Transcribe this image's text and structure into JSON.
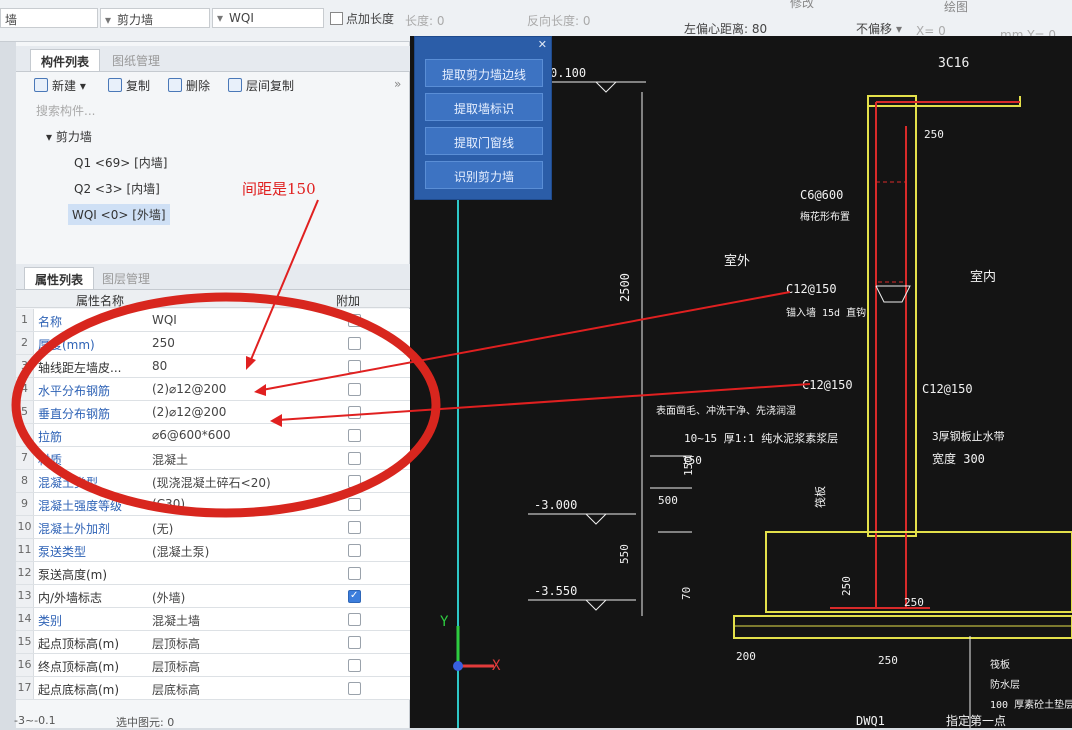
{
  "toolbar": {
    "first_drop": "墙",
    "type_drop": "剪力墙",
    "name_drop": "WQI",
    "chk_label": "点加长度",
    "len_label": "长度: 0",
    "rev_len": "反向长度: 0",
    "offset_label": "左偏心距离: 80",
    "nooffset_drop": "不偏移",
    "x_label": "X= 0",
    "mm_label": "mm Y= 0",
    "top_tab1": "修改",
    "top_tab2": "绘图"
  },
  "left": {
    "tabs": [
      "构件列表",
      "图纸管理"
    ],
    "buttons": [
      "新建",
      "复制",
      "删除",
      "层间复制"
    ],
    "search_placeholder": "搜索构件...",
    "tree_root": "剪力墙",
    "tree_items": [
      "Q1 <69> [内墙]",
      "Q2 <3> [内墙]",
      "WQI <0> [外墙]"
    ],
    "prop_tabs": [
      "属性列表",
      "图层管理"
    ],
    "col_name": "属性名称",
    "col_add": "附加",
    "rows": [
      {
        "n": "1",
        "name": "名称",
        "val": "WQI",
        "chk": false,
        "blue": true
      },
      {
        "n": "2",
        "name": "厚度(mm)",
        "val": "250",
        "chk": false,
        "blue": true
      },
      {
        "n": "3",
        "name": "轴线距左墙皮...",
        "val": "80",
        "chk": false,
        "blue": false
      },
      {
        "n": "4",
        "name": "水平分布钢筋",
        "val": "(2)⌀12@200",
        "chk": false,
        "blue": true
      },
      {
        "n": "5",
        "name": "垂直分布钢筋",
        "val": "(2)⌀12@200",
        "chk": false,
        "blue": true
      },
      {
        "n": "6",
        "name": "拉筋",
        "val": "⌀6@600*600",
        "chk": false,
        "blue": true
      },
      {
        "n": "7",
        "name": "材质",
        "val": "混凝土",
        "chk": false,
        "blue": true
      },
      {
        "n": "8",
        "name": "混凝土类型",
        "val": "(现浇混凝土碎石<20)",
        "chk": false,
        "blue": true
      },
      {
        "n": "9",
        "name": "混凝土强度等级",
        "val": "(C30)",
        "chk": false,
        "blue": true
      },
      {
        "n": "10",
        "name": "混凝土外加剂",
        "val": "(无)",
        "chk": false,
        "blue": true
      },
      {
        "n": "11",
        "name": "泵送类型",
        "val": "(混凝土泵)",
        "chk": false,
        "blue": true
      },
      {
        "n": "12",
        "name": "泵送高度(m)",
        "val": "",
        "chk": false,
        "blue": false
      },
      {
        "n": "13",
        "name": "内/外墙标志",
        "val": "(外墙)",
        "chk": true,
        "blue": false
      },
      {
        "n": "14",
        "name": "类别",
        "val": "混凝土墙",
        "chk": false,
        "blue": true
      },
      {
        "n": "15",
        "name": "起点顶标高(m)",
        "val": "层顶标高",
        "chk": false,
        "blue": false
      },
      {
        "n": "16",
        "name": "终点顶标高(m)",
        "val": "层顶标高",
        "chk": false,
        "blue": false
      },
      {
        "n": "17",
        "name": "起点底标高(m)",
        "val": "层底标高",
        "chk": false,
        "blue": false
      }
    ]
  },
  "float_panel": {
    "buttons": [
      "提取剪力墙边线",
      "提取墙标识",
      "提取门窗线",
      "识别剪力墙"
    ]
  },
  "annotation": "间距是150",
  "cad": {
    "texts": [
      "0.100",
      "3C16",
      "250",
      "C6@600",
      "梅花形布置",
      "室外",
      "室内",
      "C12@150",
      "锚入墙 15d 直钩",
      "C12@150",
      "C12@150",
      "表面凿毛、冲洗干净、先浇润湿",
      "10~15  厚1:1  纯水泥浆素浆层",
      "3厚钢板止水带",
      "宽度 300",
      "150",
      "150",
      "500",
      "2500",
      "-3.000",
      "-3.550",
      "550",
      "70",
      "筏板",
      "250",
      "250",
      "200",
      "250",
      "筏板",
      "防水层",
      "100 厚素砼土垫层",
      "DWQ1"
    ],
    "axis_x": "X",
    "axis_y": "Y",
    "hint": "指定第一点"
  },
  "status": {
    "coord": "-3~-0.1",
    "sel": "选中图元: 0"
  }
}
